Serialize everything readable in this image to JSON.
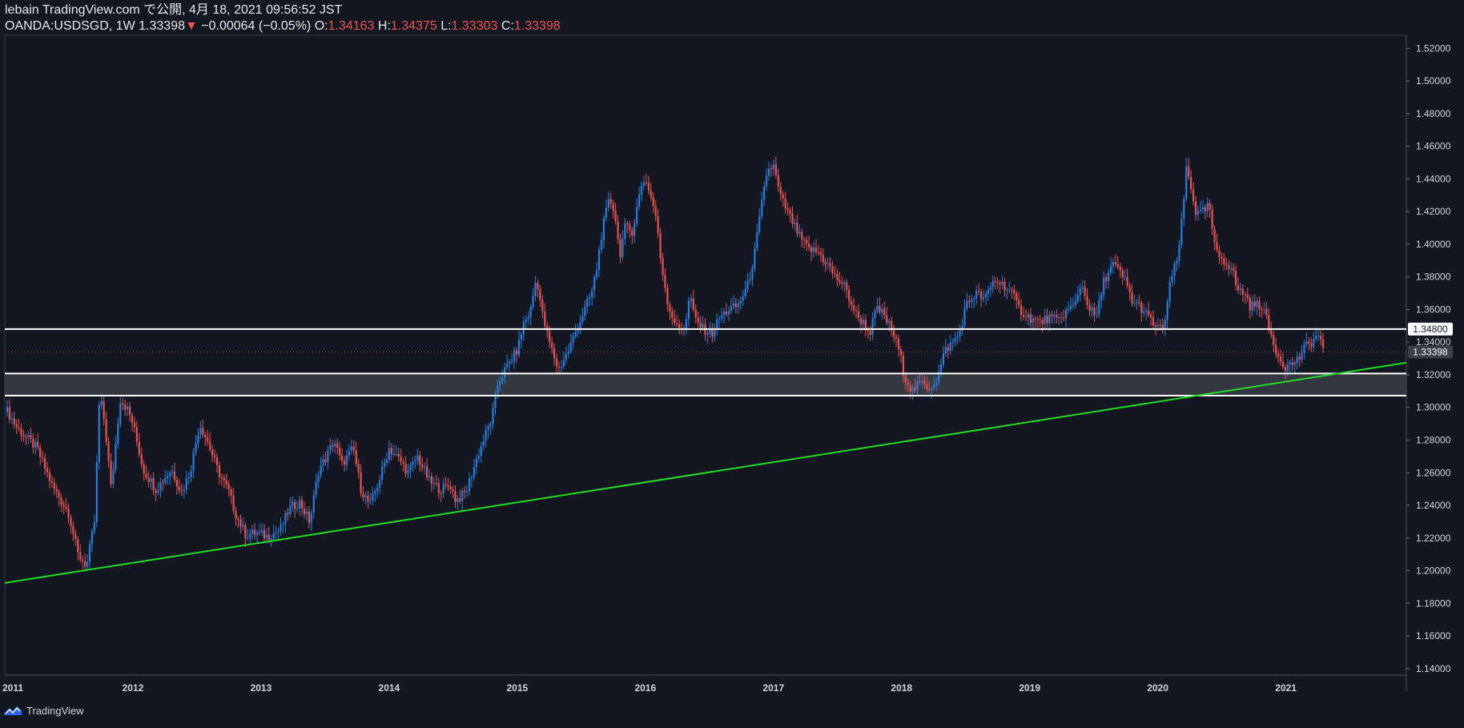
{
  "header": {
    "line1": "lebain TradingView.com で公開, 4月 18, 2021 09:56:52 JST",
    "symbol": "OANDA:USDSGD, 1W 1.33398",
    "down_arrow": "▼",
    "change": "−0.00064 (−0.05%)",
    "o_label": "O:",
    "o_value": "1.34163",
    "h_label": "H:",
    "h_value": "1.34375",
    "l_label": "L:",
    "l_value": "1.33303",
    "c_label": "C:",
    "c_value": "1.33398"
  },
  "footer": {
    "brand": "TradingView",
    "logo_icon": "tradingview-logo-icon"
  },
  "colors": {
    "background": "#131722",
    "up": "#2a7fe0",
    "down": "#ef5350",
    "trendline": "#22dd22",
    "level": "#ffffff",
    "zone": "#3a3d45",
    "grid": "#2a2e39"
  },
  "chart_data": {
    "type": "candlestick",
    "title": "",
    "xlabel": "",
    "ylabel": "",
    "x_ticks": [
      "2011",
      "2012",
      "2013",
      "2014",
      "2015",
      "2016",
      "2017",
      "2018",
      "2019",
      "2020",
      "2021"
    ],
    "y_ticks": [
      "1.14000",
      "1.16000",
      "1.18000",
      "1.20000",
      "1.22000",
      "1.24000",
      "1.26000",
      "1.28000",
      "1.30000",
      "1.32000",
      "1.34000",
      "1.36000",
      "1.38000",
      "1.40000",
      "1.42000",
      "1.44000",
      "1.46000",
      "1.48000",
      "1.50000",
      "1.52000"
    ],
    "ylim": [
      1.136,
      1.528
    ],
    "xlim": [
      2011.0,
      2021.94
    ],
    "series": [
      {
        "anchors": [
          [
            2011.0,
            1.3
          ],
          [
            2011.1,
            1.287
          ],
          [
            2011.25,
            1.275
          ],
          [
            2011.37,
            1.252
          ],
          [
            2011.5,
            1.235
          ],
          [
            2011.57,
            1.21
          ],
          [
            2011.64,
            1.203
          ],
          [
            2011.7,
            1.23
          ],
          [
            2011.74,
            1.308
          ],
          [
            2011.78,
            1.29
          ],
          [
            2011.83,
            1.25
          ],
          [
            2011.9,
            1.305
          ],
          [
            2011.95,
            1.3
          ],
          [
            2012.0,
            1.29
          ],
          [
            2012.08,
            1.262
          ],
          [
            2012.18,
            1.25
          ],
          [
            2012.3,
            1.262
          ],
          [
            2012.38,
            1.248
          ],
          [
            2012.45,
            1.262
          ],
          [
            2012.52,
            1.29
          ],
          [
            2012.58,
            1.28
          ],
          [
            2012.66,
            1.262
          ],
          [
            2012.75,
            1.248
          ],
          [
            2012.8,
            1.235
          ],
          [
            2012.88,
            1.222
          ],
          [
            2012.96,
            1.223
          ],
          [
            2013.05,
            1.221
          ],
          [
            2013.15,
            1.225
          ],
          [
            2013.22,
            1.238
          ],
          [
            2013.3,
            1.242
          ],
          [
            2013.38,
            1.23
          ],
          [
            2013.45,
            1.262
          ],
          [
            2013.5,
            1.268
          ],
          [
            2013.57,
            1.28
          ],
          [
            2013.63,
            1.265
          ],
          [
            2013.72,
            1.275
          ],
          [
            2013.78,
            1.25
          ],
          [
            2013.85,
            1.24
          ],
          [
            2013.92,
            1.255
          ],
          [
            2014.0,
            1.275
          ],
          [
            2014.08,
            1.268
          ],
          [
            2014.15,
            1.26
          ],
          [
            2014.22,
            1.27
          ],
          [
            2014.32,
            1.254
          ],
          [
            2014.4,
            1.25
          ],
          [
            2014.48,
            1.252
          ],
          [
            2014.52,
            1.243
          ],
          [
            2014.6,
            1.248
          ],
          [
            2014.68,
            1.268
          ],
          [
            2014.75,
            1.283
          ],
          [
            2014.8,
            1.293
          ],
          [
            2014.85,
            1.315
          ],
          [
            2014.92,
            1.325
          ],
          [
            2015.0,
            1.335
          ],
          [
            2015.05,
            1.352
          ],
          [
            2015.1,
            1.358
          ],
          [
            2015.15,
            1.38
          ],
          [
            2015.2,
            1.355
          ],
          [
            2015.25,
            1.34
          ],
          [
            2015.32,
            1.323
          ],
          [
            2015.4,
            1.335
          ],
          [
            2015.5,
            1.355
          ],
          [
            2015.58,
            1.37
          ],
          [
            2015.62,
            1.385
          ],
          [
            2015.65,
            1.402
          ],
          [
            2015.68,
            1.415
          ],
          [
            2015.72,
            1.428
          ],
          [
            2015.76,
            1.42
          ],
          [
            2015.8,
            1.393
          ],
          [
            2015.84,
            1.41
          ],
          [
            2015.9,
            1.408
          ],
          [
            2015.94,
            1.425
          ],
          [
            2015.98,
            1.44
          ],
          [
            2016.02,
            1.436
          ],
          [
            2016.08,
            1.418
          ],
          [
            2016.12,
            1.39
          ],
          [
            2016.18,
            1.362
          ],
          [
            2016.25,
            1.348
          ],
          [
            2016.31,
            1.35
          ],
          [
            2016.35,
            1.37
          ],
          [
            2016.38,
            1.355
          ],
          [
            2016.45,
            1.348
          ],
          [
            2016.52,
            1.345
          ],
          [
            2016.58,
            1.355
          ],
          [
            2016.65,
            1.36
          ],
          [
            2016.72,
            1.362
          ],
          [
            2016.8,
            1.375
          ],
          [
            2016.85,
            1.393
          ],
          [
            2016.9,
            1.42
          ],
          [
            2016.95,
            1.445
          ],
          [
            2017.0,
            1.448
          ],
          [
            2017.05,
            1.43
          ],
          [
            2017.12,
            1.418
          ],
          [
            2017.2,
            1.405
          ],
          [
            2017.27,
            1.397
          ],
          [
            2017.35,
            1.395
          ],
          [
            2017.42,
            1.388
          ],
          [
            2017.48,
            1.38
          ],
          [
            2017.55,
            1.375
          ],
          [
            2017.6,
            1.365
          ],
          [
            2017.65,
            1.356
          ],
          [
            2017.7,
            1.352
          ],
          [
            2017.75,
            1.345
          ],
          [
            2017.8,
            1.36
          ],
          [
            2017.85,
            1.358
          ],
          [
            2017.92,
            1.348
          ],
          [
            2017.98,
            1.335
          ],
          [
            2018.02,
            1.32
          ],
          [
            2018.08,
            1.31
          ],
          [
            2018.15,
            1.315
          ],
          [
            2018.22,
            1.312
          ],
          [
            2018.28,
            1.318
          ],
          [
            2018.34,
            1.335
          ],
          [
            2018.4,
            1.34
          ],
          [
            2018.45,
            1.345
          ],
          [
            2018.5,
            1.362
          ],
          [
            2018.58,
            1.37
          ],
          [
            2018.65,
            1.366
          ],
          [
            2018.72,
            1.378
          ],
          [
            2018.8,
            1.375
          ],
          [
            2018.86,
            1.37
          ],
          [
            2018.92,
            1.36
          ],
          [
            2019.0,
            1.355
          ],
          [
            2019.08,
            1.352
          ],
          [
            2019.15,
            1.355
          ],
          [
            2019.22,
            1.353
          ],
          [
            2019.3,
            1.36
          ],
          [
            2019.35,
            1.362
          ],
          [
            2019.4,
            1.376
          ],
          [
            2019.47,
            1.36
          ],
          [
            2019.52,
            1.355
          ],
          [
            2019.58,
            1.378
          ],
          [
            2019.65,
            1.388
          ],
          [
            2019.7,
            1.383
          ],
          [
            2019.75,
            1.377
          ],
          [
            2019.8,
            1.365
          ],
          [
            2019.86,
            1.362
          ],
          [
            2019.93,
            1.355
          ],
          [
            2020.0,
            1.348
          ],
          [
            2020.05,
            1.35
          ],
          [
            2020.1,
            1.378
          ],
          [
            2020.15,
            1.39
          ],
          [
            2020.2,
            1.422
          ],
          [
            2020.22,
            1.448
          ],
          [
            2020.26,
            1.435
          ],
          [
            2020.3,
            1.418
          ],
          [
            2020.36,
            1.42
          ],
          [
            2020.4,
            1.424
          ],
          [
            2020.45,
            1.395
          ],
          [
            2020.52,
            1.39
          ],
          [
            2020.58,
            1.385
          ],
          [
            2020.62,
            1.372
          ],
          [
            2020.68,
            1.37
          ],
          [
            2020.72,
            1.362
          ],
          [
            2020.78,
            1.363
          ],
          [
            2020.82,
            1.362
          ],
          [
            2020.86,
            1.35
          ],
          [
            2020.9,
            1.34
          ],
          [
            2020.95,
            1.33
          ],
          [
            2021.0,
            1.325
          ],
          [
            2021.05,
            1.327
          ],
          [
            2021.1,
            1.33
          ],
          [
            2021.16,
            1.338
          ],
          [
            2021.2,
            1.34
          ],
          [
            2021.26,
            1.345
          ],
          [
            2021.29,
            1.334
          ]
        ]
      }
    ],
    "horizontal_lines": [
      {
        "price": 1.348,
        "label": "1.34800"
      },
      {
        "price": 1.3208
      },
      {
        "price": 1.3072
      }
    ],
    "support_zone": [
      1.3072,
      1.3208
    ],
    "trendline": {
      "points": [
        [
          2011.0,
          1.1925
        ],
        [
          2021.94,
          1.3274
        ]
      ]
    },
    "last_price_label": "1.33398",
    "last_price": 1.33398
  }
}
